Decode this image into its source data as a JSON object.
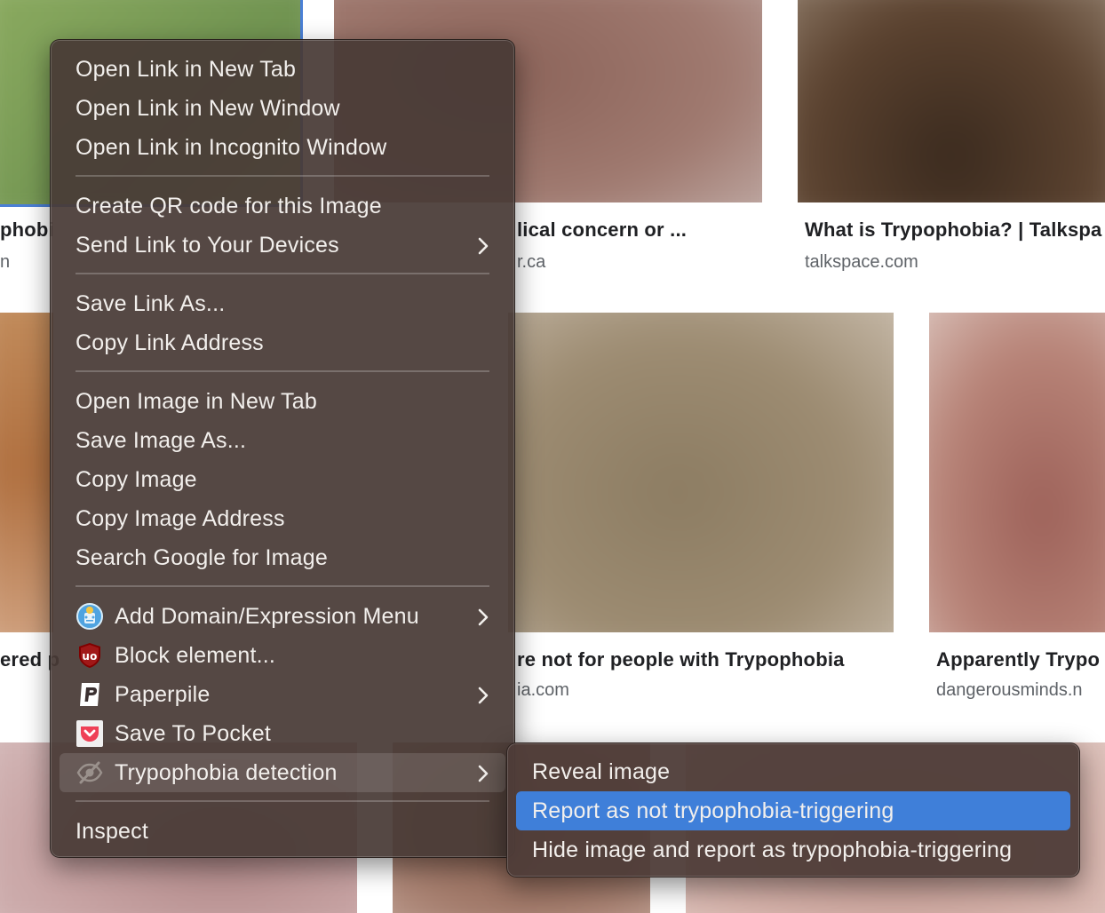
{
  "background": {
    "results": [
      {
        "title": "phobi",
        "source": "n"
      },
      {
        "title": "lical concern or ...",
        "source": "r.ca"
      },
      {
        "title": "What is Trypophobia? | Talkspa",
        "source": "talkspace.com"
      },
      {
        "title": "ered p",
        "source": ""
      },
      {
        "title": "re not for people with Trypophobia",
        "source": "ia.com"
      },
      {
        "title": "Apparently Trypo",
        "source": "dangerousminds.n"
      }
    ]
  },
  "context_menu": {
    "groups": [
      [
        "Open Link in New Tab",
        "Open Link in New Window",
        "Open Link in Incognito Window"
      ],
      [
        "Create QR code for this Image",
        "Send Link to Your Devices"
      ],
      [
        "Save Link As...",
        "Copy Link Address"
      ],
      [
        "Open Image in New Tab",
        "Save Image As...",
        "Copy Image",
        "Copy Image Address",
        "Search Google for Image"
      ],
      [
        "Add Domain/Expression Menu",
        "Block element...",
        "Paperpile",
        "Save To Pocket",
        "Trypophobia detection"
      ],
      [
        "Inspect"
      ]
    ],
    "icons": {
      "add_domain": "add-domain-icon",
      "block_element": "ublock-icon",
      "paperpile": "paperpile-icon",
      "pocket": "pocket-icon",
      "trypophobia": "eye-slash-icon"
    }
  },
  "submenu": {
    "items": [
      "Reveal image",
      "Report as not trypophobia-triggering",
      "Hide image and report as trypophobia-triggering"
    ],
    "active_color": "#3f7fd9"
  }
}
